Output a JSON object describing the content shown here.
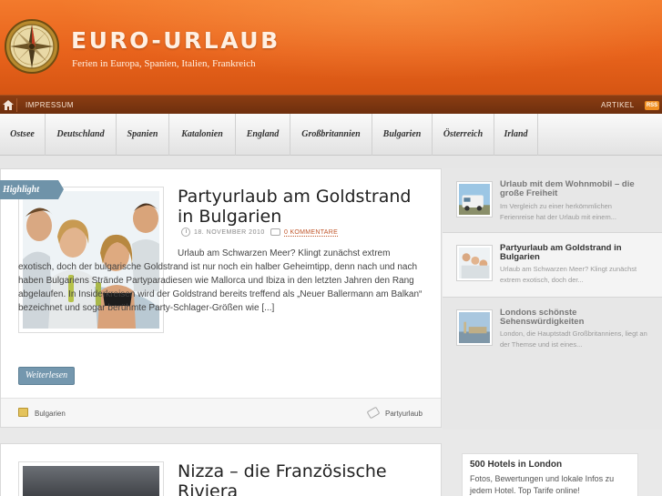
{
  "site": {
    "title": "EURO-URLAUB",
    "tagline": "Ferien in Europa, Spanien, Italien, Frankreich"
  },
  "topbar": {
    "impressum": "IMPRESSUM",
    "artikel": "ARTIKEL",
    "rss": "RSS"
  },
  "nav": {
    "items": [
      "Ostsee",
      "Deutschland",
      "Spanien",
      "Katalonien",
      "England",
      "Großbritannien",
      "Bulgarien",
      "Österreich",
      "Irland"
    ]
  },
  "featured": {
    "badge": "Highlight",
    "title": "Partyurlaub am Goldstrand in Bulgarien",
    "date": "18. NOVEMBER 2010",
    "comments": "0 KOMMENTARE",
    "excerpt": "Urlaub am Schwarzen Meer? Klingt zunächst extrem exotisch, doch der bulgarische Goldstrand ist nur noch ein halber Geheimtipp, denn nach und nach haben Bulgariens Strände Partyparadiesen wie Mallorca und Ibiza in den letzten Jahren den Rang abgelaufen. In Insiderkreisen wird der Goldstrand bereits treffend als „Neuer Ballermann am Balkan“ bezeichnet und sogar berühmte Party-Schlager-Größen wie [...]",
    "readmore": "Weiterlesen",
    "category": "Bulgarien",
    "tag": "Partyurlaub"
  },
  "second_post": {
    "title": "Nizza – die Französische Riviera"
  },
  "sidebar": {
    "items": [
      {
        "title": "Urlaub mit dem Wohnmobil – die große Freiheit",
        "text": "Im Vergleich zu einer herkömmlichen Ferienreise hat der Urlaub mit einem..."
      },
      {
        "title": "Partyurlaub am Goldstrand in Bulgarien",
        "text": "Urlaub am Schwarzen Meer? Klingt zunächst extrem exotisch, doch der..."
      },
      {
        "title": "Londons schönste Sehenswürdigkeiten",
        "text": "London, die Hauptstadt Großbritanniens, liegt an der Themse und ist eines..."
      }
    ],
    "widget": {
      "title": "500 Hotels in London",
      "text": "Fotos, Bewertungen und lokale Infos zu jedem Hotel. Top Tarife online!"
    }
  },
  "colors": {
    "header_orange": "#e8631c",
    "topbar_brown": "#7a3410",
    "accent_blue": "#7497ae",
    "link_orange": "#c0562a"
  }
}
